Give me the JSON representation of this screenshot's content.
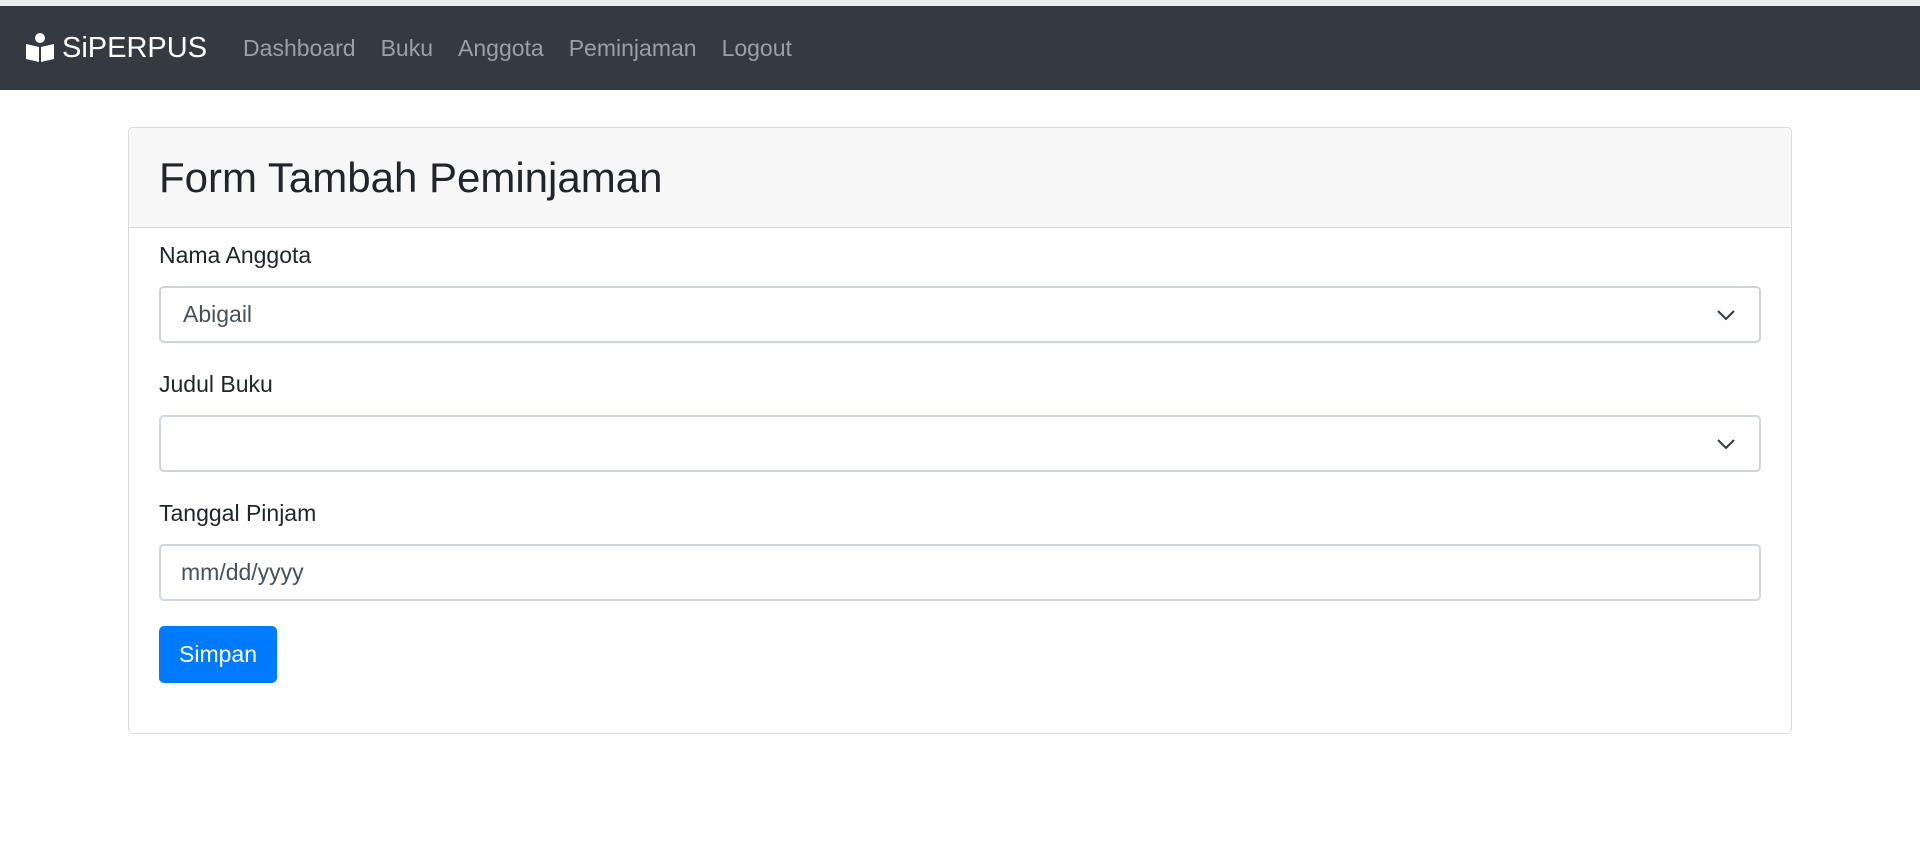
{
  "navbar": {
    "brand": "SiPERPUS",
    "brand_icon": "reader-icon",
    "links": [
      "Dashboard",
      "Buku",
      "Anggota",
      "Peminjaman",
      "Logout"
    ],
    "background": "#343a40"
  },
  "form": {
    "title": "Form Tambah Peminjaman",
    "fields": {
      "anggota": {
        "label": "Nama Anggota",
        "value": "Abigail"
      },
      "buku": {
        "label": "Judul Buku",
        "value": ""
      },
      "tanggal": {
        "label": "Tanggal Pinjam",
        "placeholder": "mm/dd/yyyy"
      }
    },
    "submit_label": "Simpan",
    "submit_color": "#007bff"
  }
}
